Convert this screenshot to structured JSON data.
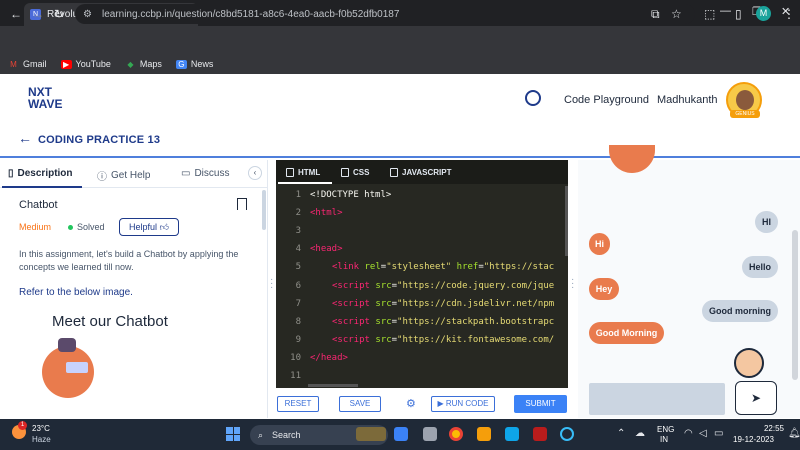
{
  "browser": {
    "tab_title": "Revolutionizing the Job Market",
    "tab_favicon": "N",
    "url": "learning.ccbp.in/question/c8bd5181-a8c6-4ea0-aacb-f0b52dfb0187",
    "profile_initial": "M",
    "bookmarks": [
      {
        "label": "Gmail",
        "icon": "gmail-icon"
      },
      {
        "label": "YouTube",
        "icon": "youtube-icon"
      },
      {
        "label": "Maps",
        "icon": "maps-icon"
      },
      {
        "label": "News",
        "icon": "news-icon"
      }
    ]
  },
  "header": {
    "logo_line1": "NXT",
    "logo_line2": "WAVE",
    "playground_label": "Code Playground",
    "user_name": "Madhukanth",
    "badge_label": "GENIUS"
  },
  "practice": {
    "title": "CODING PRACTICE 13"
  },
  "left_panel": {
    "tabs": [
      "Description",
      "Get Help",
      "Discuss"
    ],
    "question_title": "Chatbot",
    "difficulty": "Medium",
    "status": "Solved",
    "helpful_label": "Helpful",
    "description": "In this assignment, let's build a Chatbot by applying the concepts we learned till now.",
    "refer_text": "Refer to the below image.",
    "preview_heading": "Meet our Chatbot"
  },
  "editor": {
    "tabs": [
      "HTML",
      "CSS",
      "JAVASCRIPT"
    ],
    "line_numbers": [
      "1",
      "2",
      "3",
      "4",
      "5",
      "6",
      "7",
      "8",
      "9",
      "10",
      "11"
    ]
  },
  "actions": {
    "reset": "RESET",
    "save": "SAVE",
    "run_code": "▶ RUN CODE",
    "submit": "SUBMIT"
  },
  "chat": {
    "messages": [
      {
        "side": "right",
        "text": "HI"
      },
      {
        "side": "left",
        "text": "Hi"
      },
      {
        "side": "right",
        "text": "Hello"
      },
      {
        "side": "left",
        "text": "Hey"
      },
      {
        "side": "right",
        "text": "Good morning"
      },
      {
        "side": "left",
        "text": "Good Morning"
      }
    ],
    "colors": {
      "bot": "#e97b4d",
      "user": "#cbd5e1"
    }
  },
  "taskbar": {
    "temperature": "23°C",
    "condition": "Haze",
    "search_placeholder": "Search",
    "lang_line1": "ENG",
    "lang_line2": "IN",
    "time": "22:55",
    "date": "19-12-2023",
    "notification_count": "1"
  }
}
